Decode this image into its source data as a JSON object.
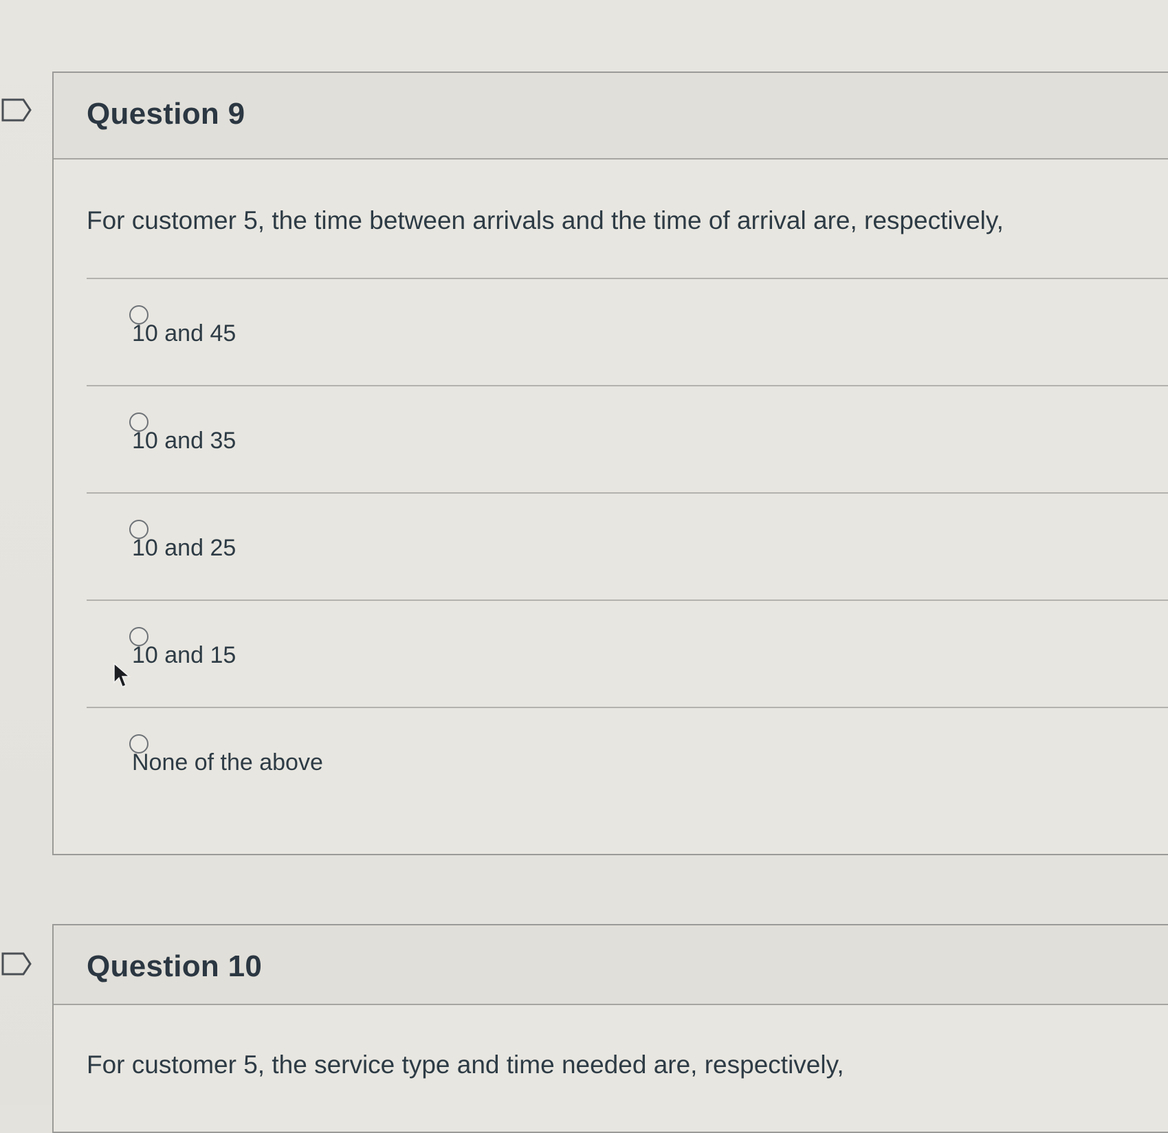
{
  "questions": [
    {
      "title": "Question 9",
      "text": "For customer 5, the time between arrivals and the time of arrival are, respectively,",
      "answers": [
        {
          "label": "10 and 45",
          "selected": false
        },
        {
          "label": "10 and 35",
          "selected": false
        },
        {
          "label": "10 and 25",
          "selected": false
        },
        {
          "label": "10 and 15",
          "selected": false
        },
        {
          "label": "None of the above",
          "selected": false
        }
      ]
    },
    {
      "title": "Question 10",
      "text": "For customer 5, the service type and time needed are, respectively,"
    }
  ],
  "icons": {
    "flag": "flag-question-icon",
    "cursor": "mouse-pointer-icon",
    "radio": "radio-unselected-icon"
  },
  "colors": {
    "page_background": "#e4e2dc",
    "text": "#2d3b45",
    "border": "#9a9a98"
  }
}
